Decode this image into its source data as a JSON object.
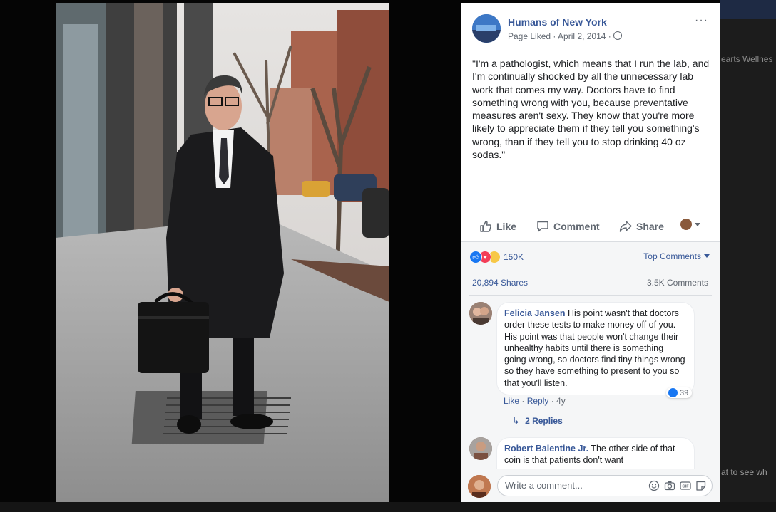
{
  "post": {
    "page_name": "Humans of New York",
    "meta": "Page Liked · April 2, 2014 ·",
    "caption": "\"I'm a pathologist, which means that I run the lab, and I'm continually shocked by all the unnecessary lab work that comes my way. Doctors have to find something wrong with you, because preventative measures aren't sexy. They know that you're more likely to appreciate them if they tell you something's wrong, than if they tell you to stop drinking 40 oz sodas.\"",
    "more_label": "···"
  },
  "actions": {
    "like": "Like",
    "comment": "Comment",
    "share": "Share"
  },
  "stats": {
    "reactions": "150K",
    "top_comments": "Top Comments",
    "shares": "20,894 Shares",
    "comments": "3.5K Comments"
  },
  "comments": [
    {
      "author": "Felicia Jansen",
      "text": " His point wasn't that doctors order these tests to make money off of you. His point was that people won't change their unhealthy habits until there is something going wrong, so doctors find tiny things wrong so they have something to present to you so that you'll listen.",
      "like_link": "Like",
      "reply_link": "Reply",
      "age": "4y",
      "reaction_count": "39",
      "replies_label": "2 Replies"
    },
    {
      "author": "Robert Balentine Jr.",
      "text": " The other side of that coin is that patients don't want"
    }
  ],
  "composer": {
    "placeholder": "Write a comment..."
  },
  "background": {
    "items": [
      "earts Wellnes",
      "at to see wh"
    ]
  },
  "colors": {
    "link_blue": "#385898",
    "reaction_like": "#1877f2",
    "reaction_love": "#f33e58"
  },
  "icons": [
    "globe-icon",
    "more-icon",
    "like-icon",
    "comment-icon",
    "share-icon",
    "camera-icon",
    "gif-icon",
    "sticker-icon",
    "emoji-icon"
  ]
}
